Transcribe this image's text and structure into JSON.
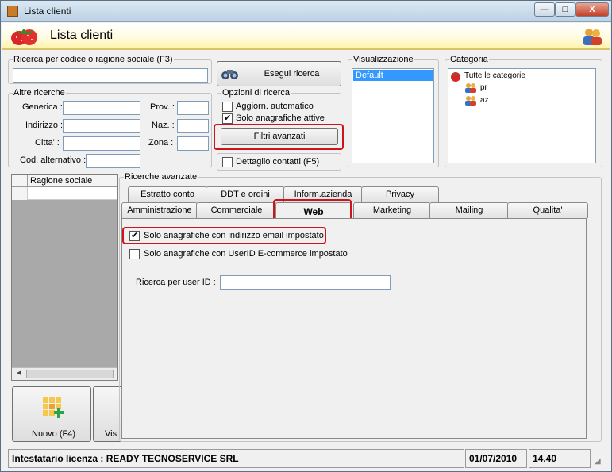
{
  "window": {
    "title": "Lista clienti",
    "min": "—",
    "max": "□",
    "close": "X"
  },
  "header": {
    "title": "Lista clienti"
  },
  "search_main": {
    "legend": "Ricerca per codice o ragione sociale (F3)",
    "value": ""
  },
  "search_button": "Esegui ricerca",
  "other_search": {
    "legend": "Altre ricerche",
    "generica": "Generica :",
    "indirizzo": "Indirizzo :",
    "citta": "Citta' :",
    "cod_alt": "Cod. alternativo :",
    "prov": "Prov. :",
    "naz": "Naz. :",
    "zona": "Zona :"
  },
  "options": {
    "legend": "Opzioni di ricerca",
    "auto_update": "Aggiorn. automatico",
    "active_only": "Solo anagrafiche attive",
    "advanced_filters": "Filtri avanzati",
    "contact_detail": "Dettaglio contatti (F5)"
  },
  "view": {
    "legend": "Visualizzazione",
    "items": [
      "Default"
    ]
  },
  "category": {
    "legend": "Categoria",
    "root": "Tutte le categorie",
    "children": [
      "pr",
      "az"
    ]
  },
  "grid": {
    "col_header": "Ragione sociale"
  },
  "advanced": {
    "legend": "Ricerche avanzate",
    "tabs_row1": [
      "Estratto conto",
      "DDT e ordini",
      "Inform.azienda",
      "Privacy"
    ],
    "tabs_row2": [
      "Amministrazione",
      "Commerciale",
      "Web",
      "Marketing",
      "Mailing",
      "Qualita'"
    ],
    "active_tab": "Web",
    "email_only": "Solo anagrafiche con indirizzo email impostato",
    "userid_only": "Solo anagrafiche con UserID E-commerce impostato",
    "user_id_label": "Ricerca per user ID :",
    "user_id_value": ""
  },
  "bottom_buttons": {
    "new": "Nuovo (F4)",
    "view_partial": "Vis"
  },
  "statusbar": {
    "license": "Intestatario licenza : READY TECNOSERVICE SRL",
    "date": "01/07/2010",
    "time": "14.40"
  }
}
